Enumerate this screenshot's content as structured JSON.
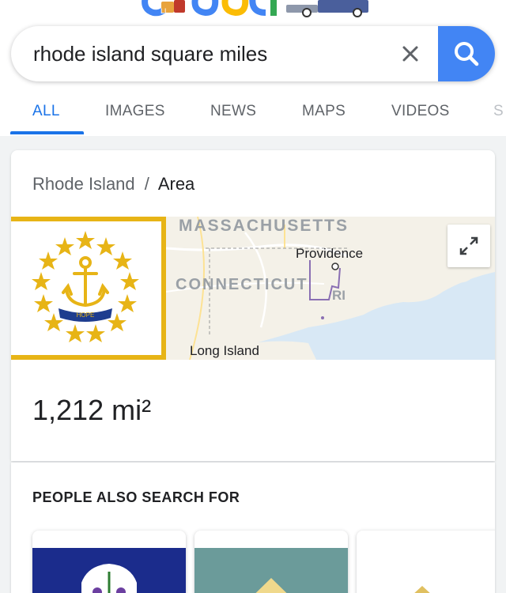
{
  "search": {
    "query": "rhode island square miles"
  },
  "tabs": [
    {
      "label": "ALL",
      "active": true
    },
    {
      "label": "IMAGES",
      "active": false
    },
    {
      "label": "NEWS",
      "active": false
    },
    {
      "label": "MAPS",
      "active": false
    },
    {
      "label": "VIDEOS",
      "active": false
    },
    {
      "label": "S",
      "active": false
    }
  ],
  "card": {
    "breadcrumb_parent": "Rhode Island",
    "breadcrumb_separator": "/",
    "breadcrumb_current": "Area",
    "flag_motto": "HOPE",
    "map_labels": {
      "massachusetts": "MASSACHUSETTS",
      "providence": "Providence",
      "connecticut": "CONNECTICUT",
      "ri": "RI",
      "long_island": "Long Island"
    },
    "area_value": "1,212 mi²"
  },
  "people_also_search": {
    "title": "PEOPLE ALSO SEARCH FOR"
  },
  "colors": {
    "accent": "#1a73e8",
    "search_button": "#4285f4",
    "flag_gold": "#e7b416",
    "flag_blue": "#1e3d8f",
    "ct_flag_blue": "#1b2c8c",
    "de_flag_teal": "#6b9b9a",
    "map_water": "#d8e8f5"
  },
  "icons": [
    "doodle-logo-icon",
    "clear-icon",
    "search-icon",
    "expand-icon",
    "rhode-island-flag-icon"
  ]
}
